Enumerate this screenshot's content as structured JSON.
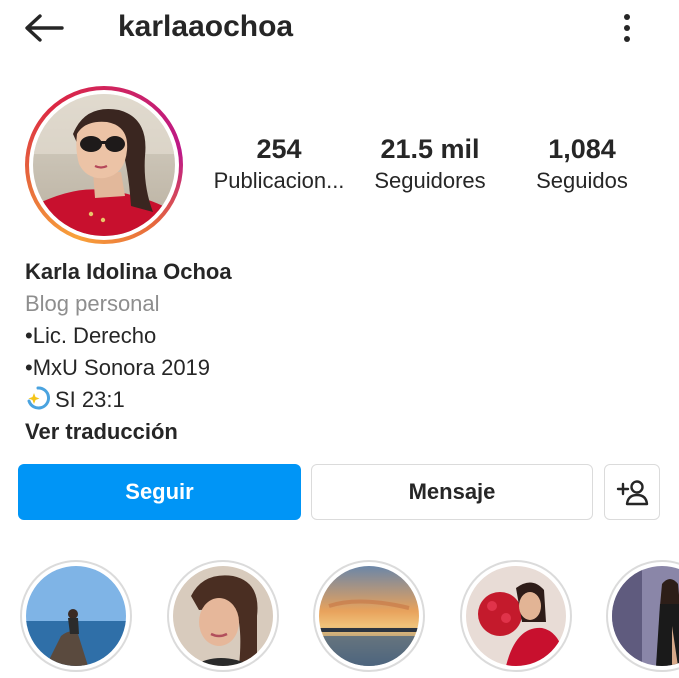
{
  "header": {
    "username": "karlaaochoa",
    "back_icon": "arrow-left-icon",
    "more_icon": "more-vertical-icon"
  },
  "profile": {
    "avatar_icon": "avatar-photo",
    "stats": [
      {
        "value": "254",
        "label": "Publicacion..."
      },
      {
        "value": "21.5 mil",
        "label": "Seguidores"
      },
      {
        "value": "1,084",
        "label": "Seguidos"
      }
    ]
  },
  "bio": {
    "name": "Karla Idolina Ochoa",
    "category": "Blog personal",
    "lines": [
      "•Lic. Derecho",
      "•MxU Sonora 2019",
      "SI 23:1"
    ],
    "translate": "Ver traducción"
  },
  "actions": {
    "follow_label": "Seguir",
    "message_label": "Mensaje",
    "add_user_icon": "add-user-icon"
  },
  "colors": {
    "primary_button": "#0095f6",
    "muted_text": "#8e8e8e",
    "border": "#dbdbdb"
  }
}
